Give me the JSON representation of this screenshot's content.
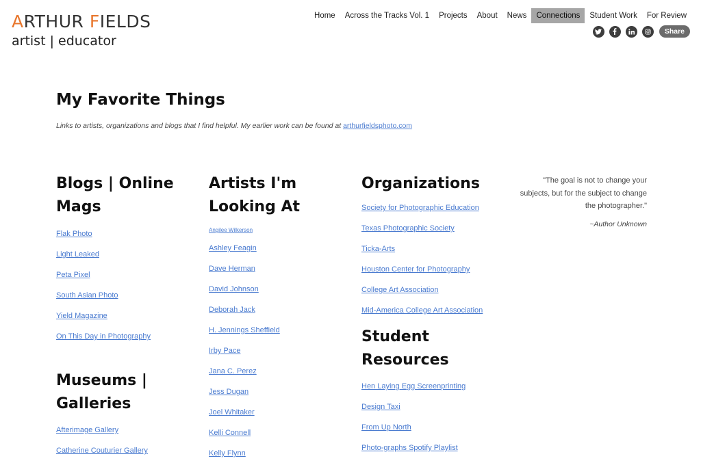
{
  "logo": {
    "first_letter": "A",
    "rest": "RTHUR ",
    "second_letter": "F",
    "rest2": "IELDS",
    "subtitle": "artist | educator"
  },
  "nav": {
    "items": [
      "Home",
      "Across the Tracks Vol. 1",
      "Projects",
      "About",
      "News",
      "Connections",
      "Student Work",
      "For Review"
    ],
    "active": "Connections"
  },
  "social": {
    "icons": [
      "twitter-icon",
      "facebook-icon",
      "linkedin-icon",
      "instagram-icon"
    ],
    "share_label": "Share"
  },
  "page": {
    "title": "My Favorite Things",
    "intro": "Links to artists, organizations and blogs that I find helpful.   My earlier work can be found at ",
    "intro_link": "arthurfieldsphoto.com"
  },
  "blogs": {
    "heading_line1": "Blogs | Online",
    "heading_line2": "Mags",
    "links": [
      "Flak Photo",
      "Light Leaked",
      "Peta Pixel",
      "South Asian Photo",
      "Yield Magazine",
      "On This Day in Photography"
    ]
  },
  "museums": {
    "heading_line1": "Museums |",
    "heading_line2": "Galleries",
    "links": [
      "Afterimage Gallery",
      "Catherine Couturier Gallery"
    ]
  },
  "artists": {
    "heading_line1": "Artists I'm",
    "heading_line2": "Looking At",
    "first_link": "Angilee Wilkerson",
    "links": [
      "Ashley Feagin",
      "Dave Herman",
      "David Johnson",
      "Deborah Jack",
      "H. Jennings Sheffield",
      "Irby Pace",
      "Jana C. Perez",
      "Jess Dugan",
      "Joel Whitaker",
      "Kelli Connell",
      "Kelly Flynn"
    ]
  },
  "organizations": {
    "heading": "Organizations",
    "links": [
      "Society for Photographic Education",
      "Texas Photographic Society",
      "Ticka-Arts",
      "Houston Center for Photography",
      "College Art Association",
      "Mid-America College Art Association"
    ]
  },
  "student_resources": {
    "heading_line1": "Student",
    "heading_line2": "Resources",
    "links": [
      "Hen Laying Egg Screenprinting",
      "Design Taxi",
      "From Up North",
      "Photo-graphs Spotify Playlist"
    ]
  },
  "quote": {
    "line1": "\"The goal is not to change your",
    "line2": "subjects, but for the subject to change",
    "line3": "the photographer.\"",
    "author": "~Author Unknown"
  },
  "colors": {
    "accent": "#e8762c",
    "link": "#4a7bd0",
    "active_nav": "#a6a6a6"
  }
}
